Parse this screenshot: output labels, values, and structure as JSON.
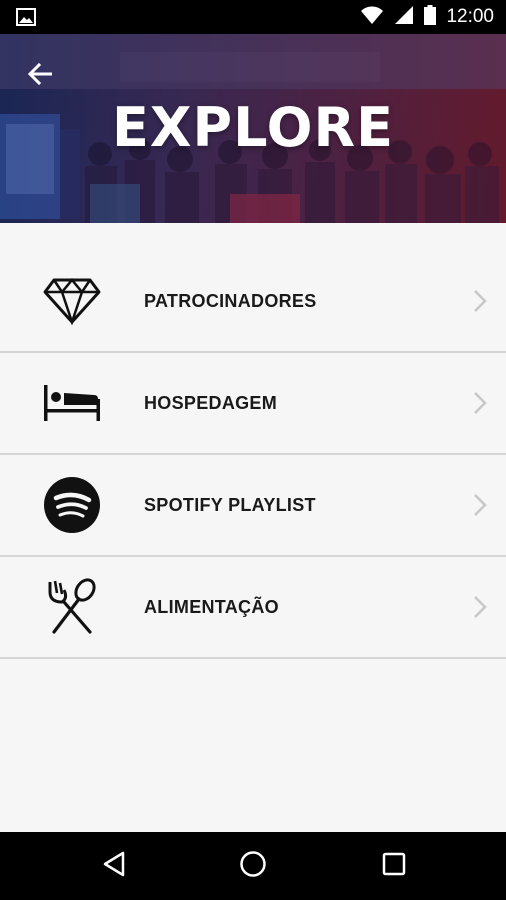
{
  "status_bar": {
    "time": "12:00",
    "icons": [
      "image-icon",
      "wifi-icon",
      "signal-icon",
      "battery-icon"
    ]
  },
  "header": {
    "title": "EXPLORE",
    "back_icon": "arrow-left-icon"
  },
  "menu": {
    "items": [
      {
        "label": "PATROCINADORES",
        "icon": "diamond-icon"
      },
      {
        "label": "HOSPEDAGEM",
        "icon": "bed-icon"
      },
      {
        "label": "SPOTIFY PLAYLIST",
        "icon": "spotify-icon"
      },
      {
        "label": "ALIMENTAÇÃO",
        "icon": "fork-spoon-icon"
      }
    ],
    "chevron_icon": "chevron-right-icon"
  },
  "nav_bar": {
    "buttons": [
      "back-triangle-icon",
      "home-circle-icon",
      "recents-square-icon"
    ]
  },
  "colors": {
    "status_bar": "#000000",
    "list_background": "#f6f6f6",
    "divider": "#d4d4d4",
    "label_text": "#1a1a1a",
    "chevron": "#c8c8c8"
  }
}
